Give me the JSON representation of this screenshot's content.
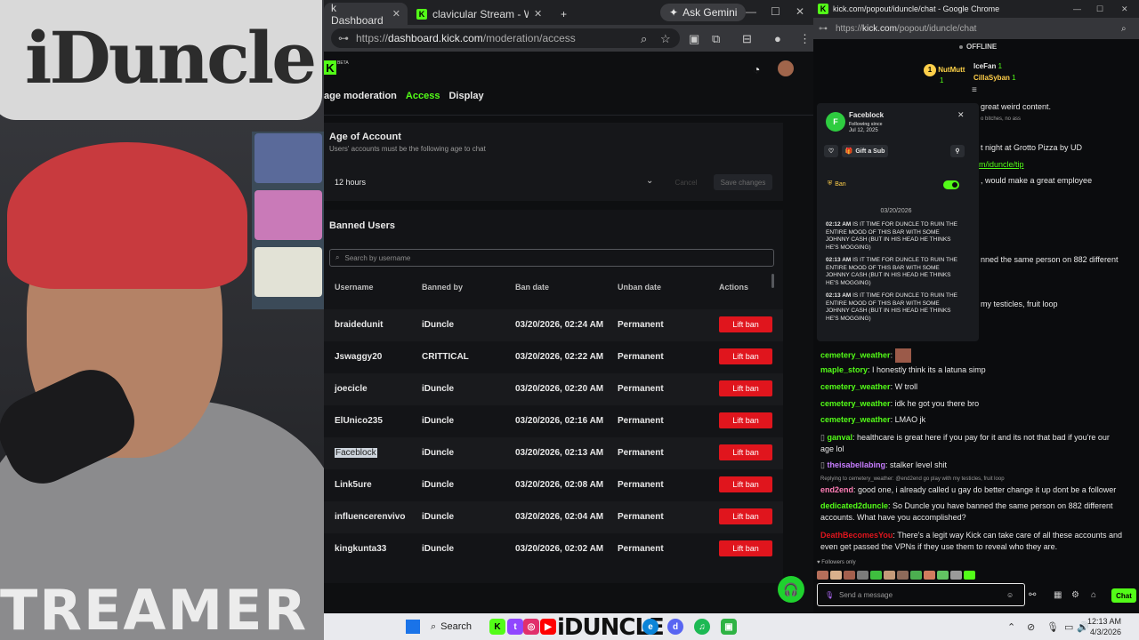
{
  "webcam": {
    "sign_text": "iDuncle",
    "shirt_text": "TREAMER"
  },
  "browser": {
    "tabs": [
      {
        "label": "k Dashboard",
        "close": "✕"
      },
      {
        "label": "clavicular Stream - Watch Live o",
        "close": "✕"
      }
    ],
    "new_tab": "+",
    "gemini": "Ask Gemini",
    "url_prefix": "https://",
    "url_host": "dashboard.kick.com",
    "url_path": "/moderation/access"
  },
  "dashboard": {
    "beta": "BETA",
    "nav": [
      {
        "label": "age moderation"
      },
      {
        "label": "Access"
      },
      {
        "label": "Display"
      }
    ],
    "age": {
      "title": "Age of Account",
      "subtitle": "Users' accounts must be the following age to chat",
      "selected": "12 hours",
      "cancel": "Cancel",
      "save": "Save changes"
    },
    "banned": {
      "title": "Banned Users",
      "search_placeholder": "Search by username",
      "columns": [
        "Username",
        "Banned by",
        "Ban date",
        "Unban date",
        "Actions"
      ],
      "rows": [
        {
          "username": "braidedunit",
          "banned_by": "iDuncle",
          "ban_date": "03/20/2026, 02:24 AM",
          "unban": "Permanent",
          "action": "Lift ban"
        },
        {
          "username": "Jswaggy20",
          "banned_by": "CRITTICAL",
          "ban_date": "03/20/2026, 02:22 AM",
          "unban": "Permanent",
          "action": "Lift ban"
        },
        {
          "username": "joecicle",
          "banned_by": "iDuncle",
          "ban_date": "03/20/2026, 02:20 AM",
          "unban": "Permanent",
          "action": "Lift ban"
        },
        {
          "username": "ElUnico235",
          "banned_by": "iDuncle",
          "ban_date": "03/20/2026, 02:16 AM",
          "unban": "Permanent",
          "action": "Lift ban"
        },
        {
          "username": "Faceblock",
          "banned_by": "iDuncle",
          "ban_date": "03/20/2026, 02:13 AM",
          "unban": "Permanent",
          "action": "Lift ban"
        },
        {
          "username": "Link5ure",
          "banned_by": "iDuncle",
          "ban_date": "03/20/2026, 02:08 AM",
          "unban": "Permanent",
          "action": "Lift ban"
        },
        {
          "username": "influencerenvivo",
          "banned_by": "iDuncle",
          "ban_date": "03/20/2026, 02:04 AM",
          "unban": "Permanent",
          "action": "Lift ban"
        },
        {
          "username": "kingkunta33",
          "banned_by": "iDuncle",
          "ban_date": "03/20/2026, 02:02 AM",
          "unban": "Permanent",
          "action": "Lift ban"
        }
      ]
    }
  },
  "chat": {
    "window_title": "kick.com/popout/iduncle/chat - Google Chrome",
    "url_prefix": "https://",
    "url_host": "kick.com",
    "url_path": "/popout/iduncle/chat",
    "status": "OFFLINE",
    "podium": {
      "first": "NutMutt",
      "first_count": "1",
      "second": "IceFan",
      "second_count": "1",
      "third": "CillaSyban",
      "third_count": "1"
    },
    "behind_lines": [
      "great weird content.",
      "o bitches, no ass",
      "t night at Grotto Pizza by UD",
      "m/iduncle/tip",
      ", would make a great employee",
      "nned the same person on 882 different",
      "my testicles, fruit loop"
    ],
    "user_card": {
      "name": "Faceblock",
      "following_label": "Following since",
      "following_date": "Jul 12, 2025",
      "gift": "Gift a Sub",
      "ban_label": "Ban",
      "date_header": "03/20/2026",
      "messages": [
        {
          "time": "02:12 AM",
          "text": "IS IT TIME FOR DUNCLE TO RUIN THE ENTIRE MOOD OF THIS BAR WITH SOME JOHNNY CASH (BUT IN HIS HEAD HE THINKS HE'S MOGGING)"
        },
        {
          "time": "02:13 AM",
          "text": "IS IT TIME FOR DUNCLE TO RUIN THE ENTIRE MOOD OF THIS BAR WITH SOME JOHNNY CASH (BUT IN HIS HEAD HE THINKS HE'S MOGGING)"
        },
        {
          "time": "02:13 AM",
          "text": "IS IT TIME FOR DUNCLE TO RUIN THE ENTIRE MOOD OF THIS BAR WITH SOME JOHNNY CASH (BUT IN HIS HEAD HE THINKS HE'S MOGGING)"
        }
      ]
    },
    "messages": [
      {
        "user": "cemetery_weather",
        "text": "",
        "color": "#53fc18"
      },
      {
        "user": "maple_story",
        "text": "I honestly think its a latuna simp",
        "color": "#53fc18"
      },
      {
        "user": "cemetery_weather",
        "text": "W troll",
        "color": "#53fc18"
      },
      {
        "user": "cemetery_weather",
        "text": "idk he got you there bro",
        "color": "#53fc18"
      },
      {
        "user": "cemetery_weather",
        "text": "LMAO jk",
        "color": "#53fc18"
      },
      {
        "user": "ganval",
        "text": "healthcare is great here if you pay for it and its not that bad if you're our",
        "color": "#53fc18"
      },
      {
        "user": "",
        "text": "age lol",
        "color": "#e9e9e9"
      },
      {
        "user": "theisabellabing",
        "text": "stalker level shit",
        "color": "#c77dff"
      },
      {
        "user": "end2end",
        "text": "good one, i already called u gay do better change it up dont be a follower",
        "color": "#ff7eb6"
      },
      {
        "user": "dedicated2duncle",
        "text": "So Duncle you have banned the same person on 882 different",
        "color": "#53fc18"
      },
      {
        "user": "",
        "text": "accounts. What have you accomplished?",
        "color": "#e9e9e9"
      },
      {
        "user": "DeathBecomesYou",
        "text": "There's a legit way Kick can take care of all these accounts and",
        "color": "#e0151d"
      },
      {
        "user": "",
        "text": "even get passed the VPNs if they use them to reveal who they are.",
        "color": "#e9e9e9"
      }
    ],
    "reply_hint": "Replying to cemetery_weather: @end2end go play with my testicles, fruit loop",
    "followers_only": "Followers only",
    "input_placeholder": "Send a message",
    "send": "Chat"
  },
  "taskbar": {
    "search": "Search",
    "brand": "iDUNCLE",
    "time": "12:13 AM",
    "date": "4/3/2026"
  }
}
